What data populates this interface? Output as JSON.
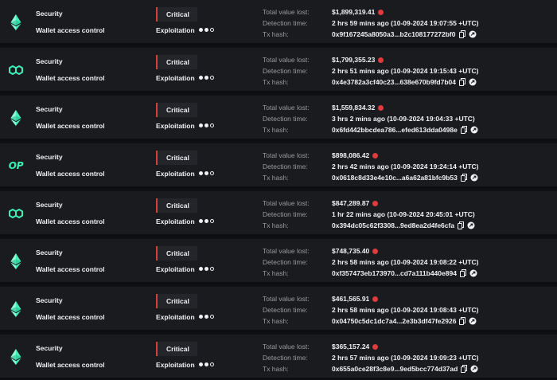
{
  "incidents": [
    {
      "chain_icon": "ethereum-icon",
      "category": "Security",
      "subcategory": "Wallet access control",
      "severity": "Critical",
      "attack_type": "Exploitation",
      "level": 2,
      "labels": {
        "value": "Total value lost:",
        "time": "Detection time:",
        "hash": "Tx hash:"
      },
      "value": "$1,899,319.41",
      "time": "2 hrs 59 mins ago (10-09-2024 19:07:55 +UTC)",
      "hash": "0x9f167245a8050a3...b2c108177272bf0"
    },
    {
      "chain_icon": "polygon-icon",
      "category": "Security",
      "subcategory": "Wallet access control",
      "severity": "Critical",
      "attack_type": "Exploitation",
      "level": 2,
      "labels": {
        "value": "Total value lost:",
        "time": "Detection time:",
        "hash": "Tx hash:"
      },
      "value": "$1,799,355.23",
      "time": "2 hrs 51 mins ago (10-09-2024 19:15:43 +UTC)",
      "hash": "0x4e3782a3cf40c23...638e670b9fd7b04"
    },
    {
      "chain_icon": "ethereum-icon",
      "category": "Security",
      "subcategory": "Wallet access control",
      "severity": "Critical",
      "attack_type": "Exploitation",
      "level": 2,
      "labels": {
        "value": "Total value lost:",
        "time": "Detection time:",
        "hash": "Tx hash:"
      },
      "value": "$1,559,834.32",
      "time": "3 hrs 2 mins ago (10-09-2024 19:04:33 +UTC)",
      "hash": "0x6fd442bbcdea786...efed613dda0498e"
    },
    {
      "chain_icon": "optimism-icon",
      "chain_text": "OP",
      "category": "Security",
      "subcategory": "Wallet access control",
      "severity": "Critical",
      "attack_type": "Exploitation",
      "level": 2,
      "labels": {
        "value": "Total value lost:",
        "time": "Detection time:",
        "hash": "Tx hash:"
      },
      "value": "$898,086.42",
      "time": "2 hrs 42 mins ago (10-09-2024 19:24:14 +UTC)",
      "hash": "0x0618c8d33e4e10c...a6a62a81bfc9b53"
    },
    {
      "chain_icon": "polygon-icon",
      "category": "Security",
      "subcategory": "Wallet access control",
      "severity": "Critical",
      "attack_type": "Exploitation",
      "level": 2,
      "labels": {
        "value": "Total value lost:",
        "time": "Detection time:",
        "hash": "Tx hash:"
      },
      "value": "$847,289.87",
      "time": "1 hr 22 mins ago (10-09-2024 20:45:01 +UTC)",
      "hash": "0x394dc05c62f3308...9ed8ea2d4fe6cfa"
    },
    {
      "chain_icon": "ethereum-icon",
      "category": "Security",
      "subcategory": "Wallet access control",
      "severity": "Critical",
      "attack_type": "Exploitation",
      "level": 2,
      "labels": {
        "value": "Total value lost:",
        "time": "Detection time:",
        "hash": "Tx hash:"
      },
      "value": "$748,735.40",
      "time": "2 hrs 58 mins ago (10-09-2024 19:08:22 +UTC)",
      "hash": "0xf357473eb173970...cd7a111b440e894"
    },
    {
      "chain_icon": "ethereum-icon",
      "category": "Security",
      "subcategory": "Wallet access control",
      "severity": "Critical",
      "attack_type": "Exploitation",
      "level": 2,
      "labels": {
        "value": "Total value lost:",
        "time": "Detection time:",
        "hash": "Tx hash:"
      },
      "value": "$461,565.91",
      "time": "2 hrs 58 mins ago (10-09-2024 19:08:43 +UTC)",
      "hash": "0x04750c5dc1dc7a4...2e3b3df47fe2926"
    },
    {
      "chain_icon": "ethereum-icon",
      "category": "Security",
      "subcategory": "Wallet access control",
      "severity": "Critical",
      "attack_type": "Exploitation",
      "level": 2,
      "labels": {
        "value": "Total value lost:",
        "time": "Detection time:",
        "hash": "Tx hash:"
      },
      "value": "$365,157.24",
      "time": "2 hrs 57 mins ago (10-09-2024 19:09:23 +UTC)",
      "hash": "0x655a0ce28f3c8e9...9ed5bcc774d37ad"
    }
  ],
  "colors": {
    "critical": "#e0393e",
    "chain_green": "#3ff0b5"
  }
}
